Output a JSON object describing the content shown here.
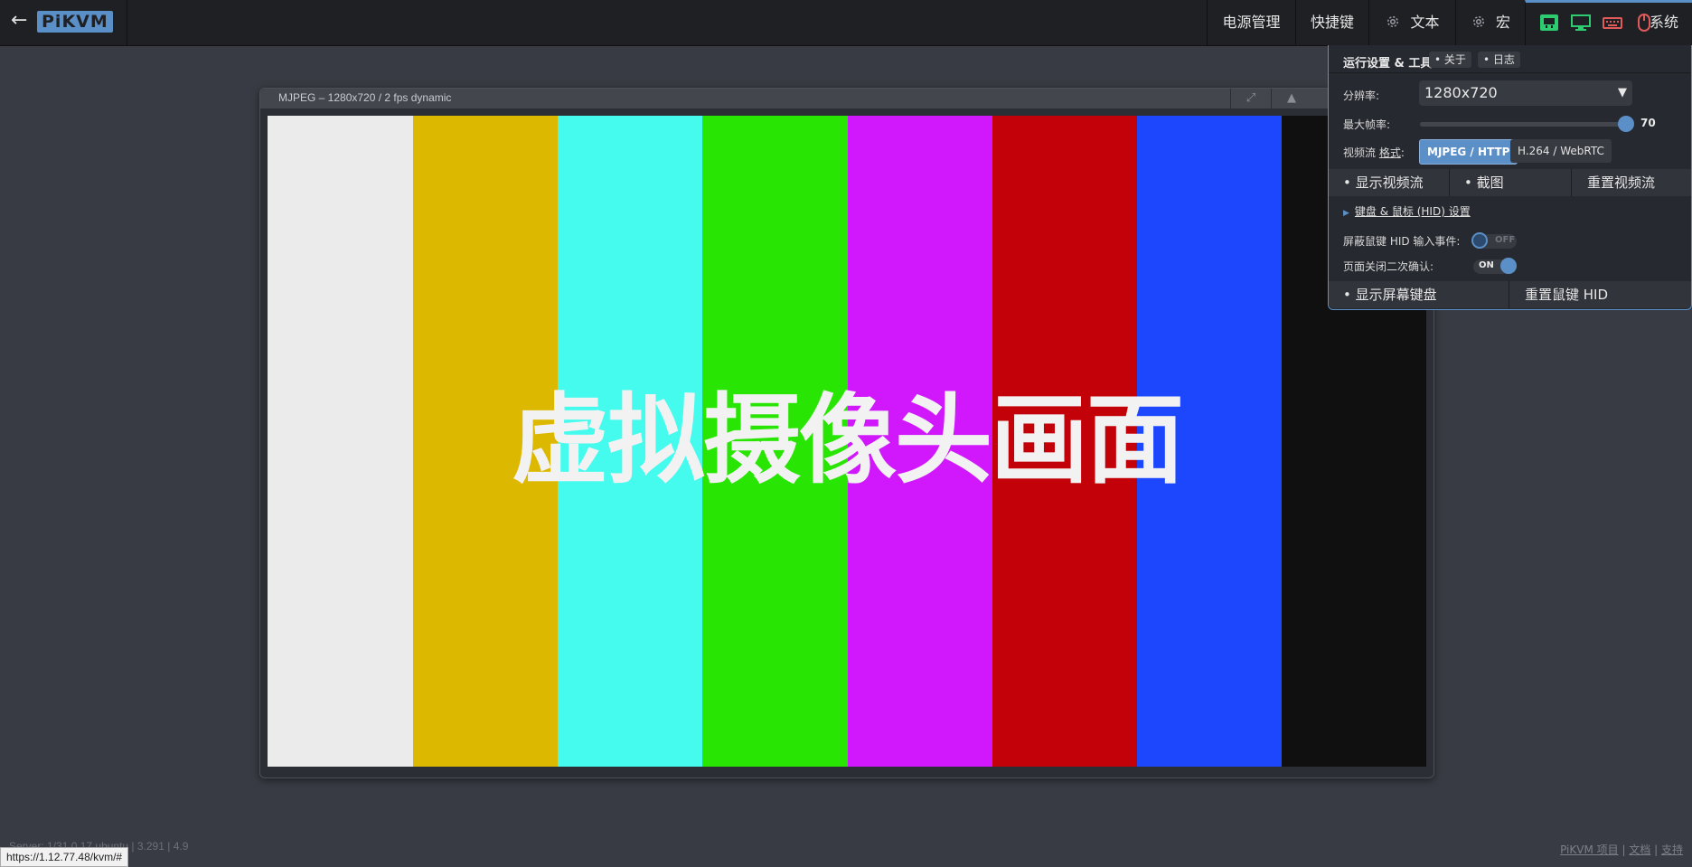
{
  "topbar": {
    "back_icon": "←",
    "logo": "PiKVM",
    "menu": {
      "power": "电源管理",
      "shortcuts": "快捷键",
      "text": "文本",
      "macro": "宏",
      "system": "系统"
    },
    "status_icons": [
      "network-icon",
      "monitor-icon",
      "keyboard-icon",
      "mouse-icon"
    ]
  },
  "stream": {
    "title": "MJPEG – 1280x720 / 2 fps dynamic",
    "fullscreen_icon": "⤢",
    "up_icon": "▲",
    "overlay_text": "虚拟摄像头画面",
    "bar_colors": [
      "#ebebeb",
      "#ddb800",
      "#45fbee",
      "#28e503",
      "#d118fd",
      "#c20108",
      "#1d47fd",
      "#101010"
    ]
  },
  "panel": {
    "title": "运行设置 & 工具",
    "about": "• 关于",
    "log": "• 日志",
    "resolution_label": "分辨率:",
    "resolution_value": "1280x720",
    "resolution_caret": "▼",
    "max_fps_label": "最大帧率:",
    "max_fps_value": "70",
    "stream_format_prefix": "视频流 ",
    "stream_format_link": "格式",
    "stream_format_suffix": ":",
    "format_options": [
      "MJPEG / HTTP",
      "H.264 / WebRTC"
    ],
    "format_selected": "MJPEG / HTTP",
    "show_stream": "• 显示视频流",
    "screenshot": "• 截图",
    "reset_stream": "重置视频流",
    "hid_settings_arrow": "▶",
    "hid_settings": "键盘 & 鼠标 (HID) 设置",
    "mute_hid_label": "屏蔽鼠键 HID 输入事件:",
    "mute_hid_state": "OFF",
    "confirm_close_label": "页面关闭二次确认:",
    "confirm_close_state": "ON",
    "show_keyboard": "• 显示屏幕键盘",
    "reset_hid": "重置鼠键 HID"
  },
  "footer": {
    "versions": "Server: 1/31.0.17 ubuntu  |  3.291  |  4.9",
    "url_tooltip": "https://1.12.77.48/kvm/#",
    "link_project": "PiKVM 项目",
    "sep1": " | ",
    "link_docs": "文档",
    "sep2": " | ",
    "link_support": "支持"
  },
  "colors": {
    "accent": "#5b8fc7",
    "topbar_bg": "#1e2024",
    "page_bg": "#383b43",
    "status_green": "#2ecc71",
    "status_red": "#e05a5a"
  }
}
